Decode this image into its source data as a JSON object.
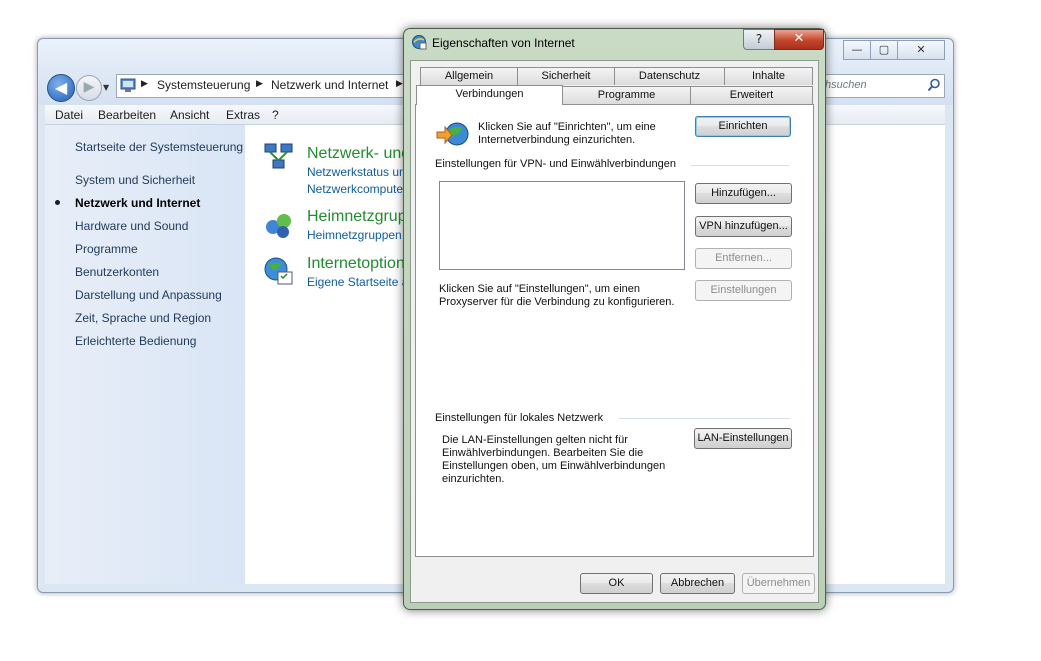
{
  "control_panel": {
    "window_buttons": {
      "minimize": "—",
      "maximize": "▢",
      "close": "✕"
    },
    "breadcrumbs": [
      "Systemsteuerung",
      "Netzwerk und Internet"
    ],
    "search_placeholder": "hsuchen",
    "menu": [
      "Datei",
      "Bearbeiten",
      "Ansicht",
      "Extras",
      "?"
    ],
    "nav": [
      "Startseite der Systemsteuerung",
      "System und Sicherheit",
      "Netzwerk und Internet",
      "Hardware und Sound",
      "Programme",
      "Benutzerkonten",
      "Darstellung und Anpassung",
      "Zeit, Sprache und Region",
      "Erleichterte Bedienung"
    ],
    "categories": [
      {
        "title": "Netzwerk- und",
        "links": [
          "Netzwerkstatus und",
          "Netzwerkcompute"
        ]
      },
      {
        "title": "Heimnetzgrupp",
        "links": [
          "Heimnetzgruppen"
        ]
      },
      {
        "title": "Internetoption",
        "links": [
          "Eigene Startseite ä"
        ]
      }
    ]
  },
  "dialog": {
    "title": "Eigenschaften von Internet",
    "help_label": "?",
    "close_label": "✕",
    "tabs_row1": [
      "Allgemein",
      "Sicherheit",
      "Datenschutz",
      "Inhalte"
    ],
    "tabs_row2": [
      "Verbindungen",
      "Programme",
      "Erweitert"
    ],
    "selected_tab": "Verbindungen",
    "setup_text_1": "Klicken Sie auf \"Einrichten\", um eine",
    "setup_text_2": "Internetverbindung einzurichten.",
    "setup_button": "Einrichten",
    "vpn_group_label": "Einstellungen für VPN- und Einwählverbindungen",
    "add_button": "Hinzufügen...",
    "add_vpn_button": "VPN hinzufügen...",
    "remove_button": "Entfernen...",
    "settings_button": "Einstellungen",
    "proxy_text_1": "Klicken Sie auf \"Einstellungen\", um einen",
    "proxy_text_2": "Proxyserver für die Verbindung zu konfigurieren.",
    "lan_group_label": "Einstellungen für lokales Netzwerk",
    "lan_text": [
      "Die LAN-Einstellungen gelten nicht für",
      "Einwählverbindungen. Bearbeiten Sie die",
      "Einstellungen oben, um Einwählverbindungen",
      "einzurichten."
    ],
    "lan_button": "LAN-Einstellungen",
    "ok_button": "OK",
    "cancel_button": "Abbrechen",
    "apply_button": "Übernehmen"
  }
}
